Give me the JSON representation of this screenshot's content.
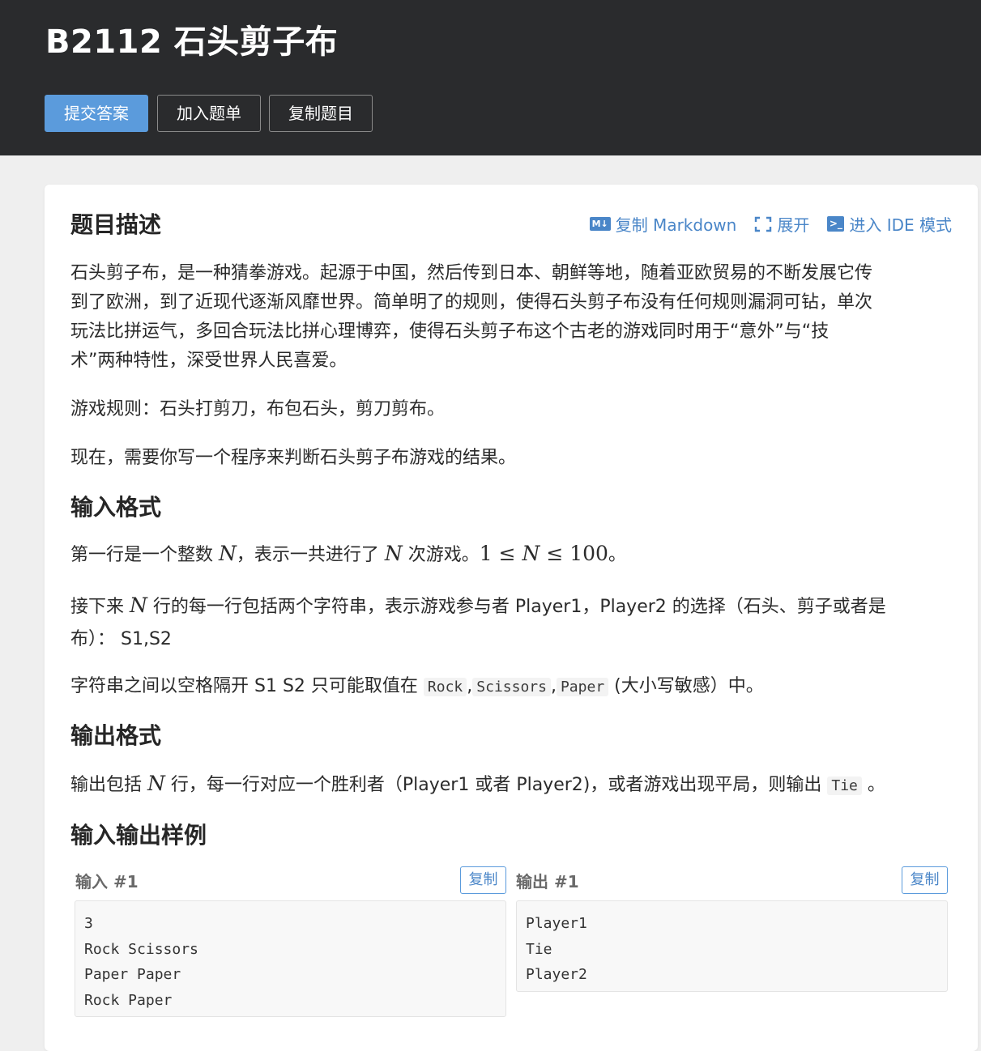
{
  "header": {
    "title": "B2112 石头剪子布",
    "buttons": {
      "submit": "提交答案",
      "add_to_list": "加入题单",
      "copy_problem": "复制题目"
    }
  },
  "toolbar": {
    "copy_markdown": "复制 Markdown",
    "expand": "展开",
    "ide_mode": "进入 IDE 模式"
  },
  "description": {
    "title": "题目描述",
    "p1_line1": "石头剪子布，是一种猜拳游戏。起源于中国，然后传到日本、朝鲜等地，随着亚欧贸易的不断发展它传",
    "p1_line2": "到了欧洲，到了近现代逐渐风靡世界。简单明了的规则，使得石头剪子布没有任何规则漏洞可钻，单次",
    "p1_line3": "玩法比拼运气，多回合玩法比拼心理博弈，使得石头剪子布这个古老的游戏同时用于“意外”与“技",
    "p1_line4": "术”两种特性，深受世界人民喜爱。",
    "p2": "游戏规则：石头打剪刀，布包石头，剪刀剪布。",
    "p3": "现在，需要你写一个程序来判断石头剪子布游戏的结果。"
  },
  "input_format": {
    "title": "输入格式",
    "p1_a": "第一行是一个整数 ",
    "var_n": "N",
    "p1_b": "，表示一共进行了 ",
    "p1_c": " 次游戏。",
    "p1_range": "1 ≤ ",
    "p1_range_b": " ≤ 100",
    "p1_end": "。",
    "p2_a": "接下来 ",
    "p2_b": " 行的每一行包括两个字符串，表示游戏参与者 Player1，Player2 的选择（石头、剪子或者是",
    "p2_line2": "布）： S1,S2",
    "p3_a": "字符串之间以空格隔开 S1 S2 只可能取值在 ",
    "opt_rock": "Rock",
    "comma": ",",
    "opt_scissors": "Scissors",
    "opt_paper": "Paper",
    "p3_b": " (大小写敏感）中。"
  },
  "output_format": {
    "title": "输出格式",
    "p1_a": "输出包括 ",
    "p1_b": " 行，每一行对应一个胜利者（Player1 或者 Player2)，或者游戏出现平局，则输出 ",
    "tie": "Tie",
    "p1_end": " 。"
  },
  "samples": {
    "title": "输入输出样例",
    "input_label": "输入 #1",
    "output_label": "输出 #1",
    "copy_label": "复制",
    "input_text": "3\nRock Scissors\nPaper Paper\nRock Paper",
    "output_text": "Player1\nTie\nPlayer2"
  }
}
